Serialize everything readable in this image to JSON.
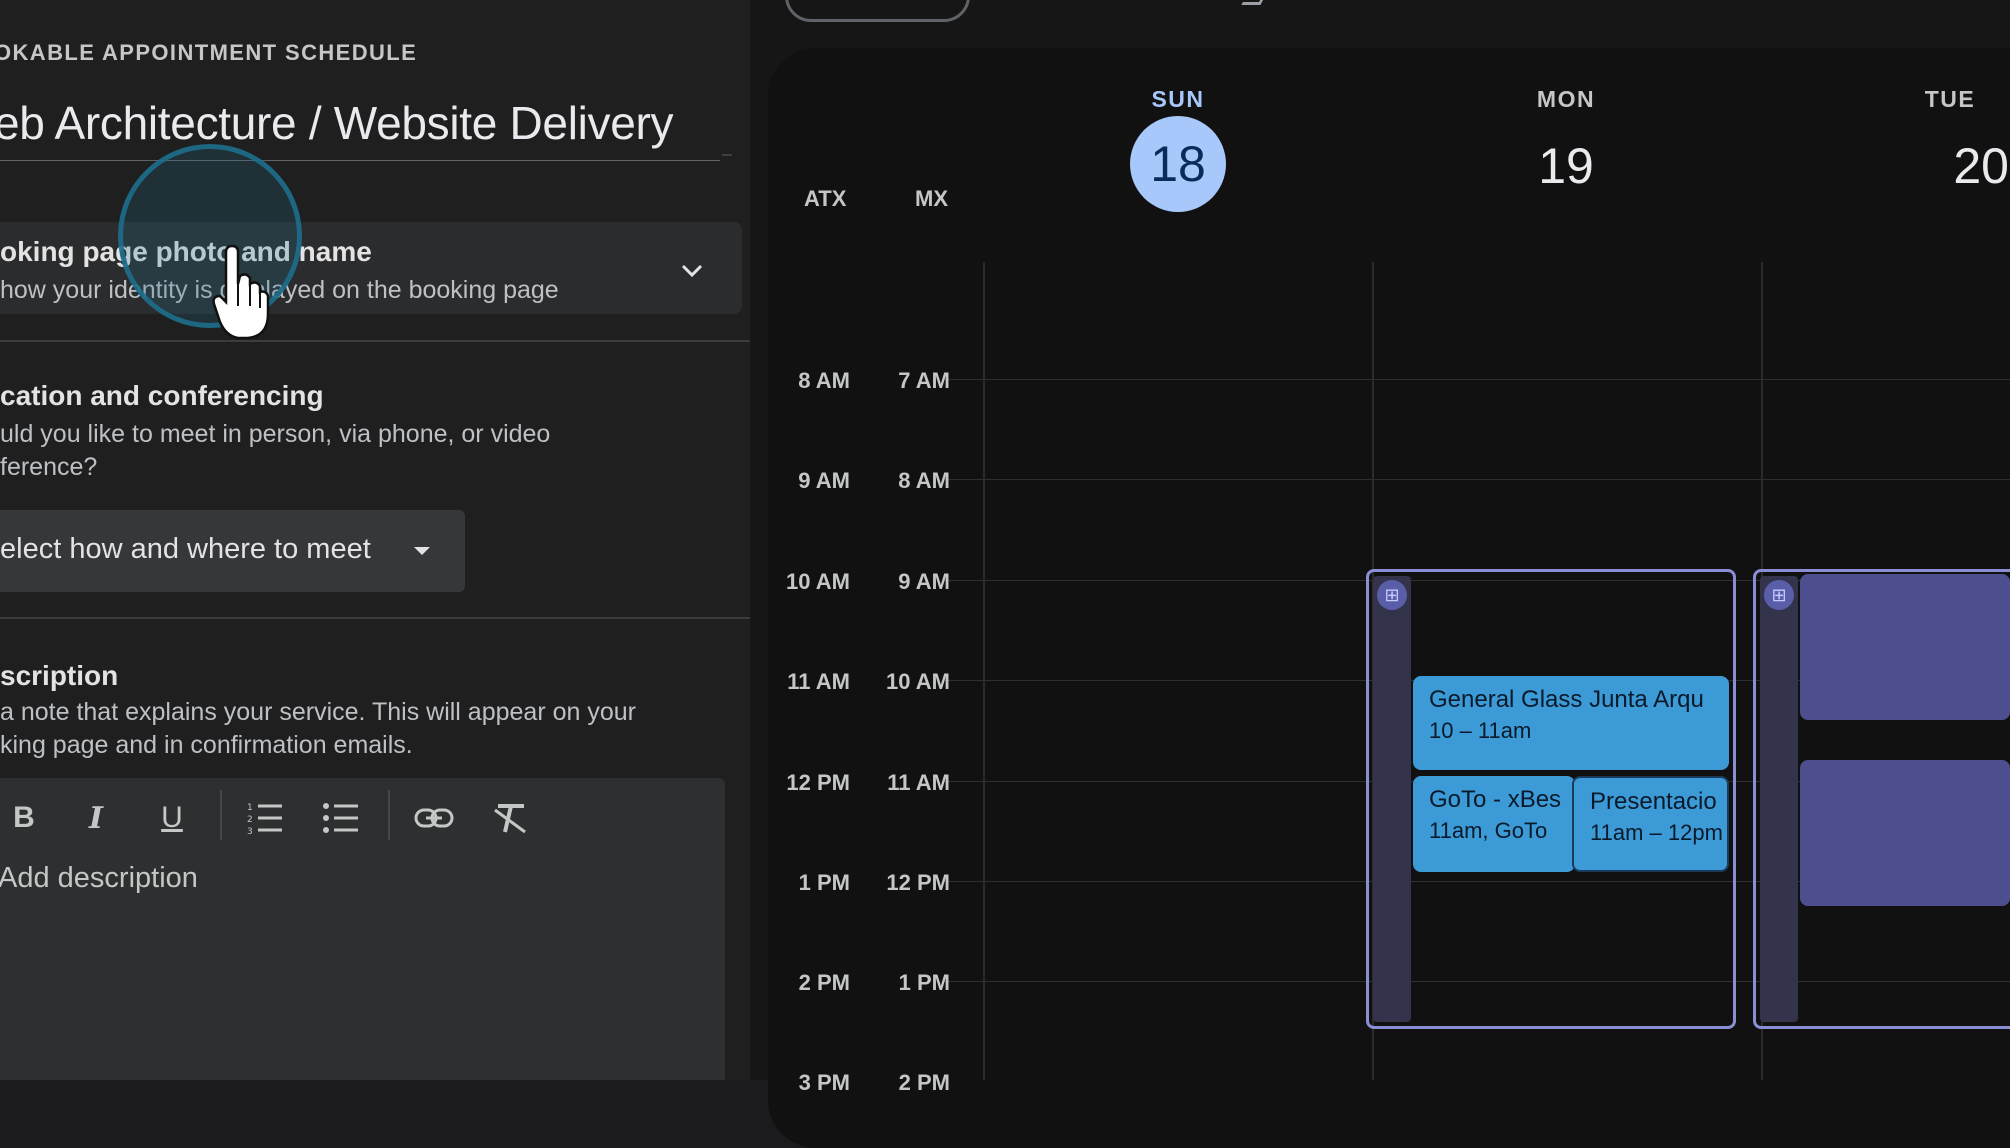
{
  "left_panel": {
    "eyebrow": "OKABLE APPOINTMENT SCHEDULE",
    "title": "eb Architecture / Website Delivery",
    "sections": [
      {
        "title": "oking page photo and name",
        "subtitle": " how your identity is displayed on the booking page",
        "icon": "chevron-down-icon"
      },
      {
        "title": "cation and conferencing",
        "subtitle_lines": [
          "uld you like to meet in person, via phone, or video",
          "ference?"
        ]
      },
      {
        "title": "scription",
        "subtitle_lines": [
          " a note that explains your service. This will appear on your",
          "king page and in confirmation emails."
        ]
      }
    ],
    "meet_select_label": "elect how and where to meet",
    "editor_toolbar": [
      {
        "name": "bold",
        "label": "B"
      },
      {
        "name": "italic",
        "label": "I"
      },
      {
        "name": "underline",
        "label": "U"
      },
      {
        "name": "numbered-list-icon"
      },
      {
        "name": "bulleted-list-icon"
      },
      {
        "name": "link-icon"
      },
      {
        "name": "clear-formatting-icon"
      }
    ],
    "description_placeholder": "Add description"
  },
  "calendar": {
    "timezones": [
      "ATX",
      "MX"
    ],
    "days": [
      {
        "name": "SUN",
        "number": "18",
        "today": true
      },
      {
        "name": "MON",
        "number": "19",
        "today": false
      },
      {
        "name": "TUE",
        "number": "20",
        "today": false
      }
    ],
    "time_rows": [
      {
        "atx": "8 AM",
        "mx": "7 AM"
      },
      {
        "atx": "9 AM",
        "mx": "8 AM"
      },
      {
        "atx": "10 AM",
        "mx": "9 AM"
      },
      {
        "atx": "11 AM",
        "mx": "10 AM"
      },
      {
        "atx": "12 PM",
        "mx": "11 AM"
      },
      {
        "atx": "1 PM",
        "mx": "12 PM"
      },
      {
        "atx": "2 PM",
        "mx": "1 PM"
      },
      {
        "atx": "3 PM",
        "mx": "2 PM"
      }
    ],
    "events": [
      {
        "title": "General Glass Junta Arqu",
        "time": "10 – 11am"
      },
      {
        "title": "GoTo - xBes",
        "time": "11am, GoTo"
      },
      {
        "title": "Presentacio",
        "time": "11am – 12pm"
      }
    ],
    "slot_icon": "calendar-grid-icon",
    "colors": {
      "today": "#a8c7fa",
      "event": "#3c9ad6",
      "slot_border": "#8a8fd4",
      "slot_block": "#4d4f8f"
    }
  }
}
